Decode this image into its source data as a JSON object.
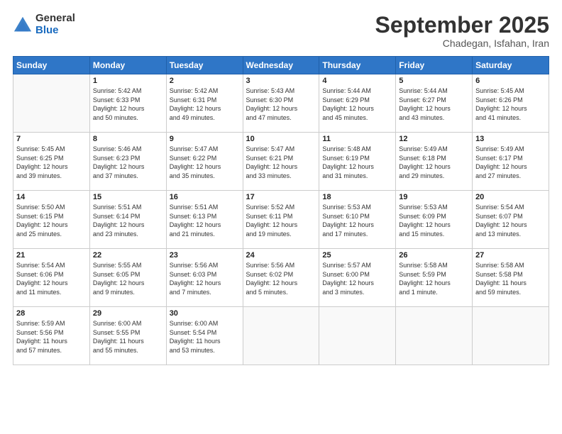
{
  "header": {
    "logo_general": "General",
    "logo_blue": "Blue",
    "month": "September 2025",
    "location": "Chadegan, Isfahan, Iran"
  },
  "days_of_week": [
    "Sunday",
    "Monday",
    "Tuesday",
    "Wednesday",
    "Thursday",
    "Friday",
    "Saturday"
  ],
  "weeks": [
    [
      {
        "day": "",
        "info": ""
      },
      {
        "day": "1",
        "info": "Sunrise: 5:42 AM\nSunset: 6:33 PM\nDaylight: 12 hours\nand 50 minutes."
      },
      {
        "day": "2",
        "info": "Sunrise: 5:42 AM\nSunset: 6:31 PM\nDaylight: 12 hours\nand 49 minutes."
      },
      {
        "day": "3",
        "info": "Sunrise: 5:43 AM\nSunset: 6:30 PM\nDaylight: 12 hours\nand 47 minutes."
      },
      {
        "day": "4",
        "info": "Sunrise: 5:44 AM\nSunset: 6:29 PM\nDaylight: 12 hours\nand 45 minutes."
      },
      {
        "day": "5",
        "info": "Sunrise: 5:44 AM\nSunset: 6:27 PM\nDaylight: 12 hours\nand 43 minutes."
      },
      {
        "day": "6",
        "info": "Sunrise: 5:45 AM\nSunset: 6:26 PM\nDaylight: 12 hours\nand 41 minutes."
      }
    ],
    [
      {
        "day": "7",
        "info": "Sunrise: 5:45 AM\nSunset: 6:25 PM\nDaylight: 12 hours\nand 39 minutes."
      },
      {
        "day": "8",
        "info": "Sunrise: 5:46 AM\nSunset: 6:23 PM\nDaylight: 12 hours\nand 37 minutes."
      },
      {
        "day": "9",
        "info": "Sunrise: 5:47 AM\nSunset: 6:22 PM\nDaylight: 12 hours\nand 35 minutes."
      },
      {
        "day": "10",
        "info": "Sunrise: 5:47 AM\nSunset: 6:21 PM\nDaylight: 12 hours\nand 33 minutes."
      },
      {
        "day": "11",
        "info": "Sunrise: 5:48 AM\nSunset: 6:19 PM\nDaylight: 12 hours\nand 31 minutes."
      },
      {
        "day": "12",
        "info": "Sunrise: 5:49 AM\nSunset: 6:18 PM\nDaylight: 12 hours\nand 29 minutes."
      },
      {
        "day": "13",
        "info": "Sunrise: 5:49 AM\nSunset: 6:17 PM\nDaylight: 12 hours\nand 27 minutes."
      }
    ],
    [
      {
        "day": "14",
        "info": "Sunrise: 5:50 AM\nSunset: 6:15 PM\nDaylight: 12 hours\nand 25 minutes."
      },
      {
        "day": "15",
        "info": "Sunrise: 5:51 AM\nSunset: 6:14 PM\nDaylight: 12 hours\nand 23 minutes."
      },
      {
        "day": "16",
        "info": "Sunrise: 5:51 AM\nSunset: 6:13 PM\nDaylight: 12 hours\nand 21 minutes."
      },
      {
        "day": "17",
        "info": "Sunrise: 5:52 AM\nSunset: 6:11 PM\nDaylight: 12 hours\nand 19 minutes."
      },
      {
        "day": "18",
        "info": "Sunrise: 5:53 AM\nSunset: 6:10 PM\nDaylight: 12 hours\nand 17 minutes."
      },
      {
        "day": "19",
        "info": "Sunrise: 5:53 AM\nSunset: 6:09 PM\nDaylight: 12 hours\nand 15 minutes."
      },
      {
        "day": "20",
        "info": "Sunrise: 5:54 AM\nSunset: 6:07 PM\nDaylight: 12 hours\nand 13 minutes."
      }
    ],
    [
      {
        "day": "21",
        "info": "Sunrise: 5:54 AM\nSunset: 6:06 PM\nDaylight: 12 hours\nand 11 minutes."
      },
      {
        "day": "22",
        "info": "Sunrise: 5:55 AM\nSunset: 6:05 PM\nDaylight: 12 hours\nand 9 minutes."
      },
      {
        "day": "23",
        "info": "Sunrise: 5:56 AM\nSunset: 6:03 PM\nDaylight: 12 hours\nand 7 minutes."
      },
      {
        "day": "24",
        "info": "Sunrise: 5:56 AM\nSunset: 6:02 PM\nDaylight: 12 hours\nand 5 minutes."
      },
      {
        "day": "25",
        "info": "Sunrise: 5:57 AM\nSunset: 6:00 PM\nDaylight: 12 hours\nand 3 minutes."
      },
      {
        "day": "26",
        "info": "Sunrise: 5:58 AM\nSunset: 5:59 PM\nDaylight: 12 hours\nand 1 minute."
      },
      {
        "day": "27",
        "info": "Sunrise: 5:58 AM\nSunset: 5:58 PM\nDaylight: 11 hours\nand 59 minutes."
      }
    ],
    [
      {
        "day": "28",
        "info": "Sunrise: 5:59 AM\nSunset: 5:56 PM\nDaylight: 11 hours\nand 57 minutes."
      },
      {
        "day": "29",
        "info": "Sunrise: 6:00 AM\nSunset: 5:55 PM\nDaylight: 11 hours\nand 55 minutes."
      },
      {
        "day": "30",
        "info": "Sunrise: 6:00 AM\nSunset: 5:54 PM\nDaylight: 11 hours\nand 53 minutes."
      },
      {
        "day": "",
        "info": ""
      },
      {
        "day": "",
        "info": ""
      },
      {
        "day": "",
        "info": ""
      },
      {
        "day": "",
        "info": ""
      }
    ]
  ]
}
